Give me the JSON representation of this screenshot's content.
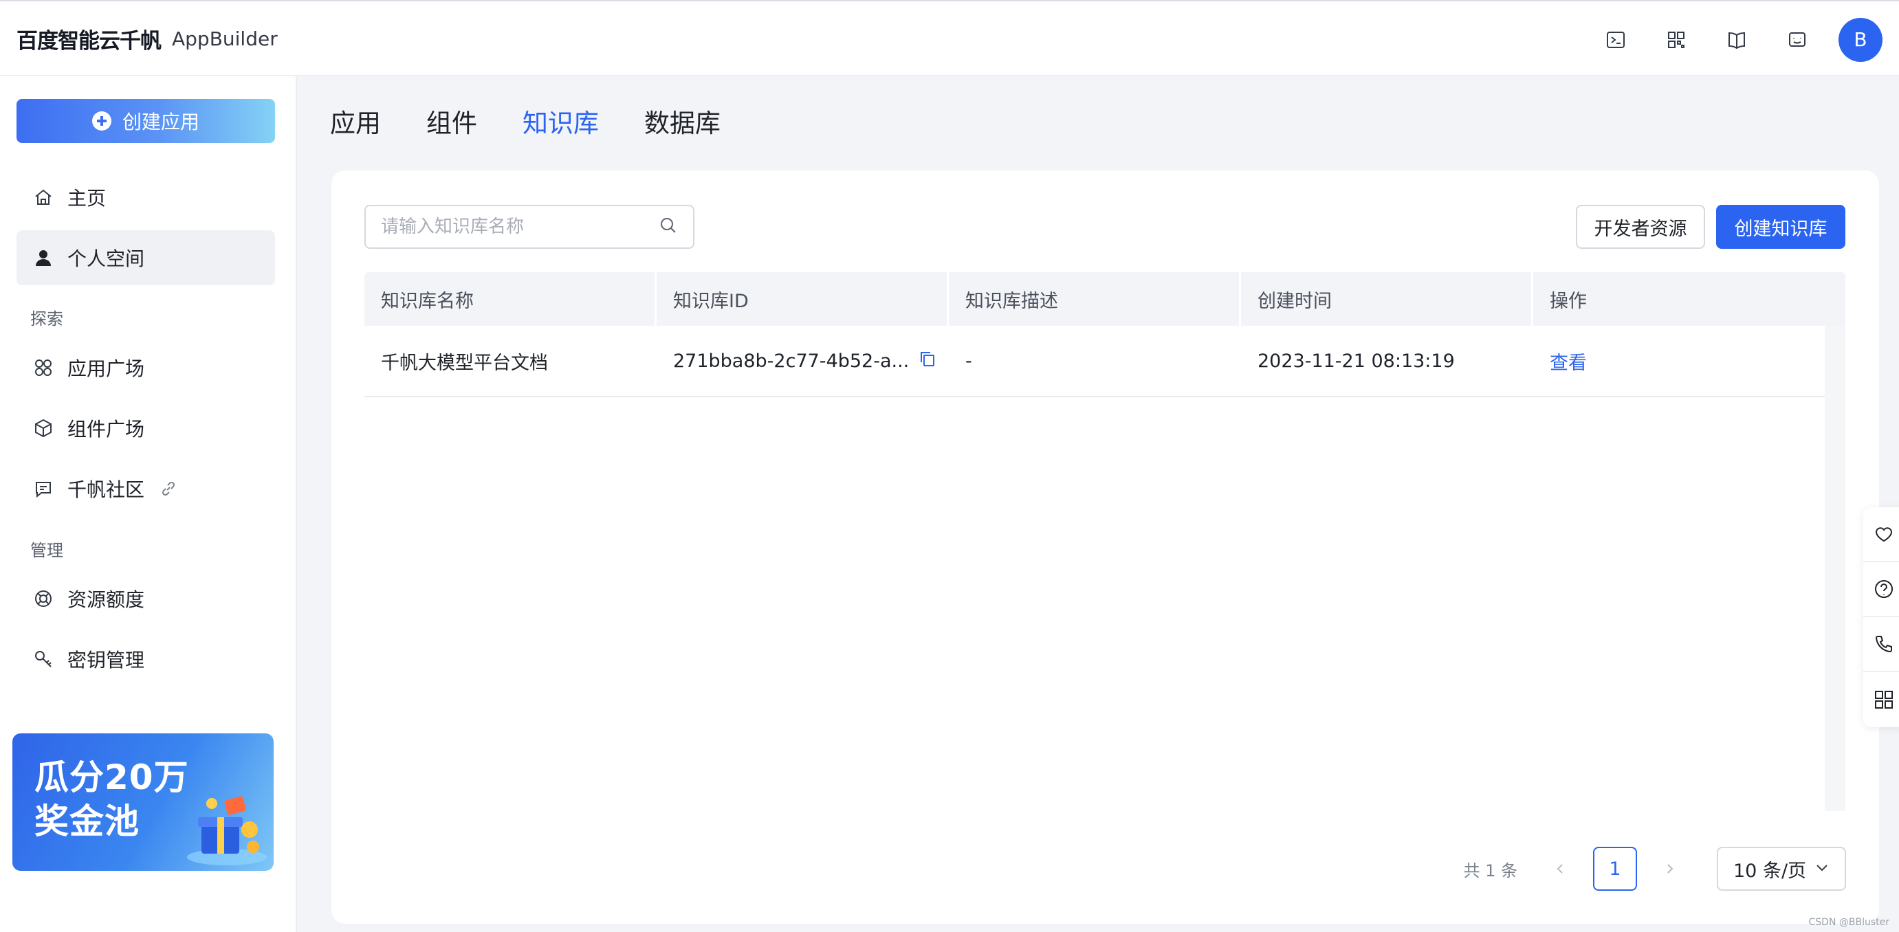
{
  "header": {
    "brand_cn": "百度智能云千帆",
    "brand_en": "AppBuilder",
    "icons": [
      "terminal-icon",
      "qr-grid-icon",
      "book-icon",
      "robot-chat-icon"
    ],
    "avatar_letter": "B"
  },
  "sidebar": {
    "create_button": "创建应用",
    "items_top": [
      {
        "label": "主页",
        "icon": "home-icon"
      },
      {
        "label": "个人空间",
        "icon": "user-icon",
        "active": true
      }
    ],
    "section_explore": "探索",
    "items_explore": [
      {
        "label": "应用广场",
        "icon": "apps-icon"
      },
      {
        "label": "组件广场",
        "icon": "cube-icon"
      },
      {
        "label": "千帆社区",
        "icon": "chat-icon",
        "external": true
      }
    ],
    "section_manage": "管理",
    "items_manage": [
      {
        "label": "资源额度",
        "icon": "lifebuoy-icon"
      },
      {
        "label": "密钥管理",
        "icon": "key-icon"
      }
    ],
    "promo": {
      "line1": "瓜分20万",
      "line2": "奖金池"
    }
  },
  "main": {
    "tabs": [
      {
        "label": "应用"
      },
      {
        "label": "组件"
      },
      {
        "label": "知识库",
        "active": true
      },
      {
        "label": "数据库"
      }
    ],
    "search": {
      "placeholder": "请输入知识库名称",
      "value": ""
    },
    "buttons": {
      "dev_resources": "开发者资源",
      "create_kb": "创建知识库"
    },
    "table": {
      "columns": [
        "知识库名称",
        "知识库ID",
        "知识库描述",
        "创建时间",
        "操作"
      ],
      "rows": [
        {
          "name": "千帆大模型平台文档",
          "id": "271bba8b-2c77-4b52-a...",
          "desc": "-",
          "created": "2023-11-21 08:13:19",
          "action": "查看"
        }
      ]
    },
    "pagination": {
      "total": "共 1 条",
      "current": "1",
      "page_size": "10 条/页"
    }
  },
  "float_toolbar": [
    "heart-chat-icon",
    "help-icon",
    "phone-icon",
    "grid-icon"
  ],
  "watermark": "CSDN @BBluster",
  "colors": {
    "primary": "#2b64f0",
    "bg": "#f3f4f7"
  }
}
